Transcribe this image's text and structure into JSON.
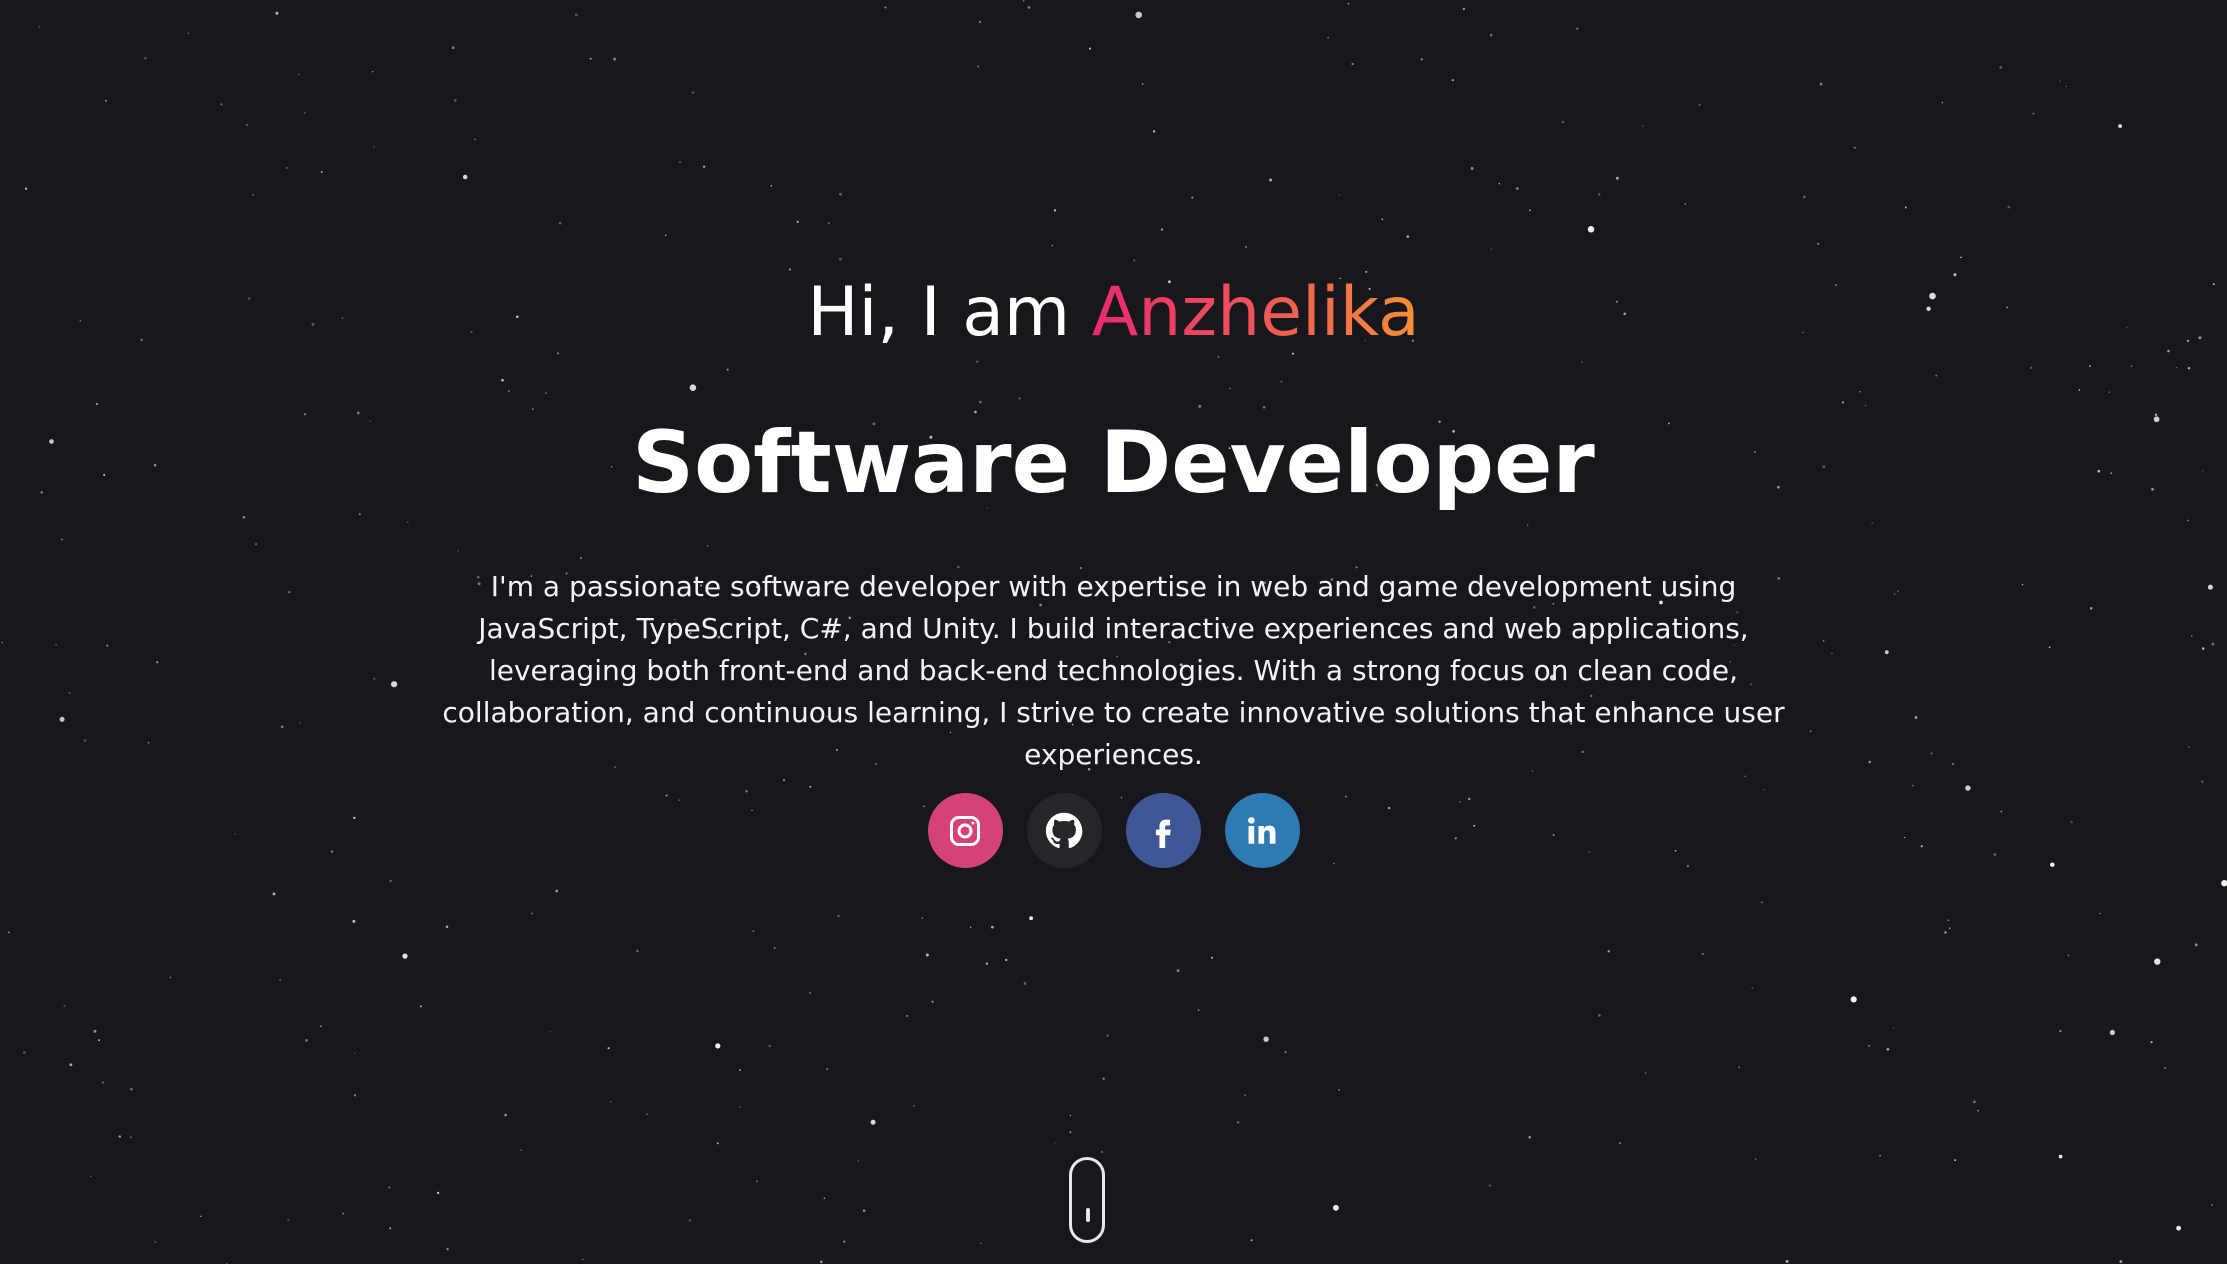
{
  "hero": {
    "greeting_prefix": "Hi, I am ",
    "name": "Anzhelika",
    "role": "Software Developer",
    "bio": "I'm a passionate software developer with expertise in web and game development using JavaScript, TypeScript, C#, and Unity. I build interactive experiences and web applications, leveraging both front-end and back-end technologies. With a strong focus on clean code, collaboration, and continuous learning, I strive to create innovative solutions that enhance user experiences."
  },
  "socials": [
    {
      "icon": "instagram-icon",
      "color": "#d5427a"
    },
    {
      "icon": "github-icon",
      "color": "#25262b"
    },
    {
      "icon": "facebook-icon",
      "color": "#3f5797"
    },
    {
      "icon": "linkedin-icon",
      "color": "#2e7ab2"
    }
  ],
  "scroll_indicator": {
    "icon": "mouse-scroll-icon"
  },
  "colors": {
    "background": "#18171d",
    "text": "#ffffff",
    "name_gradient_start": "#ea2a6c",
    "name_gradient_end": "#f39134"
  }
}
